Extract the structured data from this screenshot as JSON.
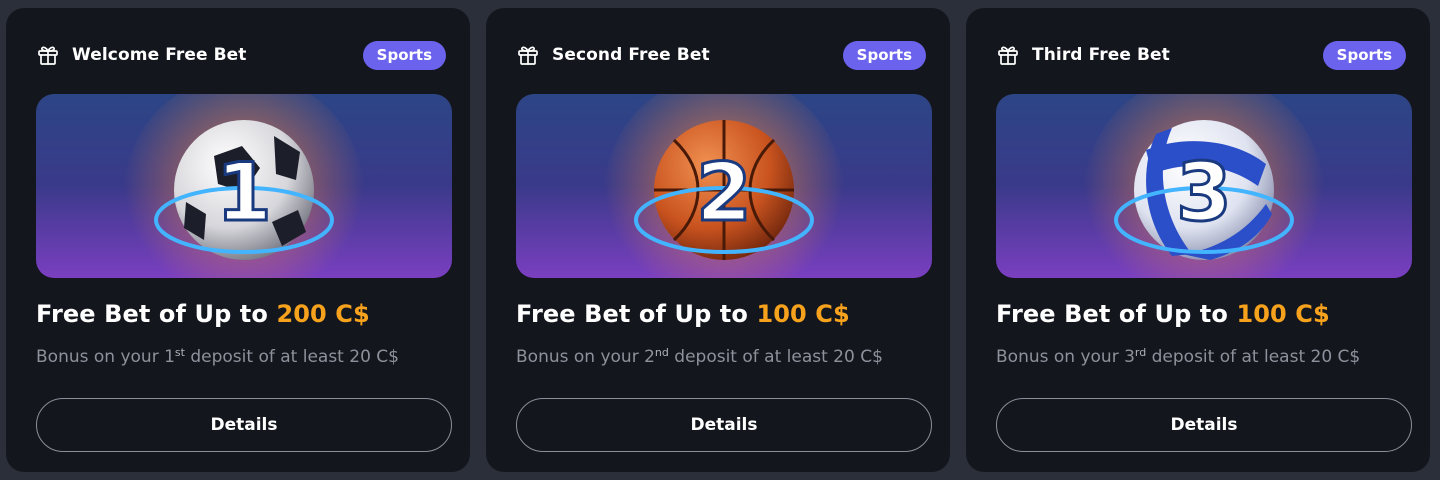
{
  "cards": [
    {
      "title": "Welcome Free Bet",
      "badge": "Sports",
      "headline_prefix": "Free Bet of Up to",
      "amount": "200 C$",
      "sub_before": "Bonus on your 1",
      "sub_ordinal": "st",
      "sub_after": " deposit of at least 20 C$",
      "button": "Details",
      "ball": "soccer-ball",
      "ball_number": "1",
      "ball_colors": {
        "main": "#e7e7ea",
        "shade": "#1c1f2a"
      }
    },
    {
      "title": "Second Free Bet",
      "badge": "Sports",
      "headline_prefix": "Free Bet of Up to",
      "amount": "100 C$",
      "sub_before": "Bonus on your 2",
      "sub_ordinal": "nd",
      "sub_after": " deposit of at least 20 C$",
      "button": "Details",
      "ball": "basketball",
      "ball_number": "2",
      "ball_colors": {
        "main": "#d9642c",
        "shade": "#7a2a10"
      }
    },
    {
      "title": "Third Free Bet",
      "badge": "Sports",
      "headline_prefix": "Free Bet of Up to",
      "amount": "100 C$",
      "sub_before": "Bonus on your 3",
      "sub_ordinal": "rd",
      "sub_after": " deposit of at least 20 C$",
      "button": "Details",
      "ball": "volleyball",
      "ball_number": "3",
      "ball_colors": {
        "main": "#e9ecf5",
        "shade": "#2b4ec9"
      }
    }
  ],
  "colors": {
    "page_bg": "#2b2f3a",
    "card_bg": "#14161e",
    "badge_bg": "#6b63ee",
    "amount": "#f7a21d",
    "subtext": "#8d919b"
  }
}
